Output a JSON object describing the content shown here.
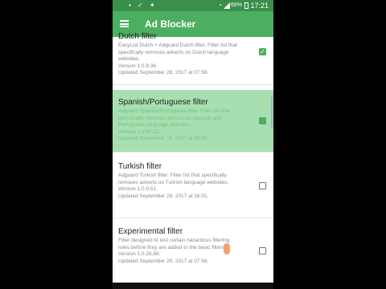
{
  "status": {
    "time": "17:21",
    "battery": "66%"
  },
  "appbar": {
    "title": "Ad Blocker"
  },
  "filters": [
    {
      "name": "Dutch filter",
      "desc": "EasyList Dutch + Adguard Dutch filter. Filter list that specifically removes adverts on Dutch language websites.",
      "version": "Version 1.0.9.36.",
      "updated": "Updated September 28, 2017 at 07:56.",
      "checked": true
    },
    {
      "name": "Spanish/Portuguese filter",
      "desc": "Adguard Spanish/Portuguese filter. Filter list that specifically removes adverts on Spanish and Portuguese language websites.",
      "version": "Version 1.0.87.23.",
      "updated": "Updated September 29, 2017 at 00:00.",
      "checked": true
    },
    {
      "name": "Turkish filter",
      "desc": "Adguard Turkish filter. Filter list that specifically removes adverts on Turkish language websites.",
      "version": "Version 1.0.9.51.",
      "updated": "Updated September 28, 2017 at 16:01.",
      "checked": false
    },
    {
      "name": "Experimental filter",
      "desc": "Filter designed to test certain hazardous filtering rules before they are added to the basic filters.",
      "version": "Version 1.0.26.68.",
      "updated": "Updated September 28, 2017 at 07:56.",
      "checked": false
    }
  ]
}
